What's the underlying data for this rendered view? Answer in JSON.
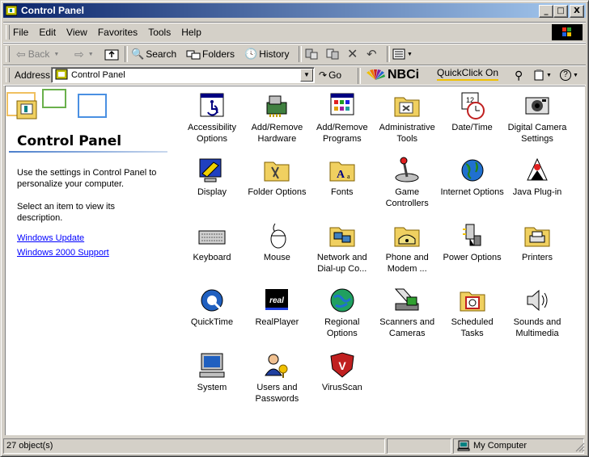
{
  "window": {
    "title": "Control Panel"
  },
  "title_buttons": {
    "minimize": "_",
    "maximize": "□",
    "close": "X"
  },
  "menu": [
    "File",
    "Edit",
    "View",
    "Favorites",
    "Tools",
    "Help"
  ],
  "toolbar": {
    "back": "Back",
    "search": "Search",
    "folders": "Folders",
    "history": "History"
  },
  "address": {
    "label": "Address",
    "value": "Control Panel",
    "go": "Go",
    "nbci": "NBCi",
    "quickclick": "QuickClick On"
  },
  "sidebar": {
    "title": "Control Panel",
    "intro": "Use the settings in Control Panel to personalize your computer.",
    "hint": "Select an item to view its description.",
    "links": [
      "Windows Update",
      "Windows 2000 Support"
    ]
  },
  "icons": [
    {
      "label": "Accessibility Options",
      "icon": "accessibility-icon"
    },
    {
      "label": "Add/Remove Hardware",
      "icon": "hardware-icon"
    },
    {
      "label": "Add/Remove Programs",
      "icon": "programs-icon"
    },
    {
      "label": "Administrative Tools",
      "icon": "admin-tools-icon"
    },
    {
      "label": "Date/Time",
      "icon": "datetime-icon"
    },
    {
      "label": "Digital Camera Settings",
      "icon": "camera-icon"
    },
    {
      "label": "Display",
      "icon": "display-icon"
    },
    {
      "label": "Folder Options",
      "icon": "folder-options-icon"
    },
    {
      "label": "Fonts",
      "icon": "fonts-icon"
    },
    {
      "label": "Game Controllers",
      "icon": "joystick-icon"
    },
    {
      "label": "Internet Options",
      "icon": "globe-icon"
    },
    {
      "label": "Java Plug-in",
      "icon": "java-icon"
    },
    {
      "label": "Keyboard",
      "icon": "keyboard-icon"
    },
    {
      "label": "Mouse",
      "icon": "mouse-icon"
    },
    {
      "label": "Network and Dial-up Co...",
      "icon": "network-icon"
    },
    {
      "label": "Phone and Modem ...",
      "icon": "phone-icon"
    },
    {
      "label": "Power Options",
      "icon": "power-icon"
    },
    {
      "label": "Printers",
      "icon": "printers-icon"
    },
    {
      "label": "QuickTime",
      "icon": "quicktime-icon"
    },
    {
      "label": "RealPlayer",
      "icon": "realplayer-icon"
    },
    {
      "label": "Regional Options",
      "icon": "regional-globe-icon"
    },
    {
      "label": "Scanners and Cameras",
      "icon": "scanner-icon"
    },
    {
      "label": "Scheduled Tasks",
      "icon": "scheduled-tasks-icon"
    },
    {
      "label": "Sounds and Multimedia",
      "icon": "speaker-icon"
    },
    {
      "label": "System",
      "icon": "computer-icon"
    },
    {
      "label": "Users and Passwords",
      "icon": "users-icon"
    },
    {
      "label": "VirusScan",
      "icon": "virusscan-icon"
    }
  ],
  "status": {
    "objects": "27 object(s)",
    "zone": "My Computer"
  }
}
